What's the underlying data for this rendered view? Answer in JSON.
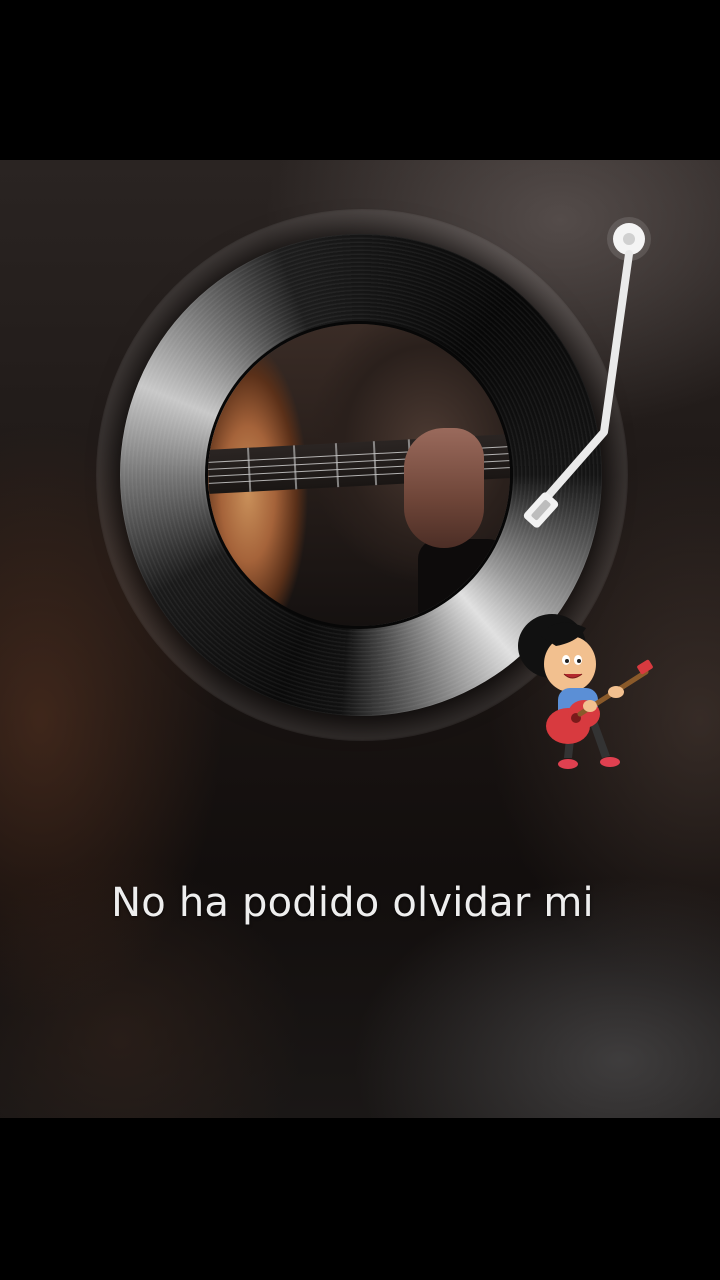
{
  "lyric": {
    "text": "No ha podido olvidar mi"
  },
  "icons": {
    "record": "vinyl-record-icon",
    "tonearm": "turntable-tonearm-icon",
    "sticker": "cartoon-boy-guitar-sticker"
  },
  "colors": {
    "letterbox": "#000000",
    "lyric_text": "#eeeeee",
    "guitar_body": "#a5633a",
    "sticker_shirt": "#5b8fd6",
    "sticker_guitar": "#d83a3f"
  }
}
